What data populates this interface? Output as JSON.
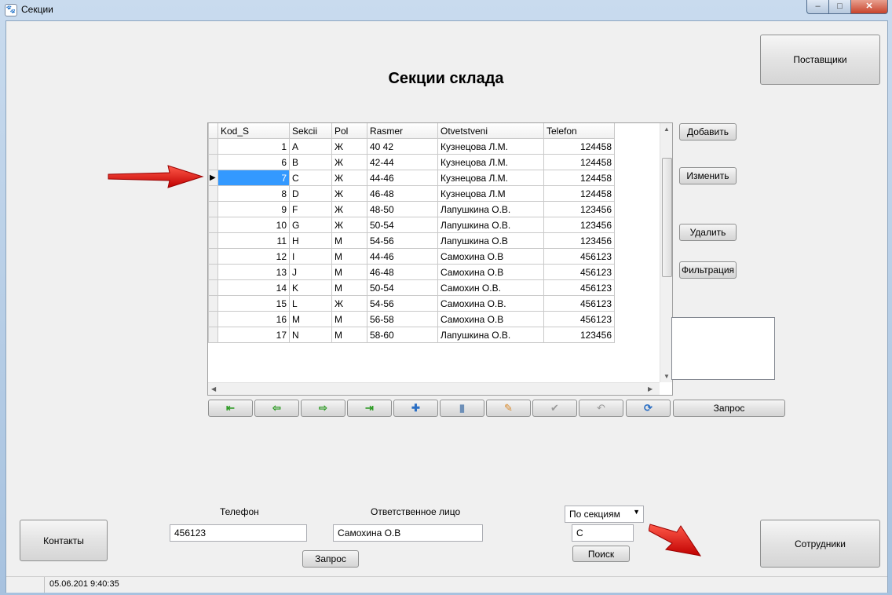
{
  "window": {
    "title": "Секции",
    "min_label": "–",
    "max_label": "□",
    "close_label": "✕"
  },
  "page_title": "Секции склада",
  "buttons": {
    "suppliers": "Поставщики",
    "add": "Добавить",
    "edit": "Изменить",
    "delete": "Удалить",
    "filter": "Фильтрация",
    "query_top": "Запрос",
    "contacts": "Контакты",
    "query_bottom": "Запрос",
    "search": "Поиск",
    "employees": "Сотрудники"
  },
  "grid": {
    "columns": [
      "Kod_S",
      "Sekcii",
      "Pol",
      "Rasmer",
      "Otvetstveni",
      "Telefon"
    ],
    "rows": [
      [
        "1",
        "A",
        "Ж",
        "40 42",
        "Кузнецова Л.М.",
        "124458"
      ],
      [
        "6",
        "B",
        "Ж",
        "42-44",
        "Кузнецова Л.М.",
        "124458"
      ],
      [
        "7",
        "C",
        "Ж",
        "44-46",
        "Кузнецова Л.М.",
        "124458"
      ],
      [
        "8",
        "D",
        "Ж",
        "46-48",
        "Кузнецова Л.М",
        "124458"
      ],
      [
        "9",
        "F",
        "Ж",
        "48-50",
        "Лапушкина О.В.",
        "123456"
      ],
      [
        "10",
        "G",
        "Ж",
        "50-54",
        "Лапушкина О.В.",
        "123456"
      ],
      [
        "11",
        "H",
        "М",
        "54-56",
        "Лапушкина О.В",
        "123456"
      ],
      [
        "12",
        "I",
        "М",
        "44-46",
        "Самохина О.В",
        "456123"
      ],
      [
        "13",
        "J",
        "М",
        "46-48",
        "Самохина О.В",
        "456123"
      ],
      [
        "14",
        "K",
        "М",
        "50-54",
        "Самохин О.В.",
        "456123"
      ],
      [
        "15",
        "L",
        "Ж",
        "54-56",
        "Самохина О.В.",
        "456123"
      ],
      [
        "16",
        "M",
        "М",
        "56-58",
        "Самохина О.В",
        "456123"
      ],
      [
        "17",
        "N",
        "М",
        "58-60",
        "Лапушкина О.В.",
        "123456"
      ]
    ],
    "selected_row": 2
  },
  "navigator": [
    {
      "name": "first",
      "glyph": "⇤"
    },
    {
      "name": "prior",
      "glyph": "⇦"
    },
    {
      "name": "next",
      "glyph": "⇨"
    },
    {
      "name": "last",
      "glyph": "⇥"
    },
    {
      "name": "insert",
      "glyph": "✚"
    },
    {
      "name": "delete",
      "glyph": "▮"
    },
    {
      "name": "edit",
      "glyph": "✎"
    },
    {
      "name": "post",
      "glyph": "✔"
    },
    {
      "name": "cancel",
      "glyph": "↶"
    },
    {
      "name": "refresh",
      "glyph": "⟳"
    }
  ],
  "labels": {
    "phone": "Телефон",
    "responsible": "Ответственное лицо"
  },
  "inputs": {
    "phone": "456123",
    "responsible": "Самохина О.В",
    "search": "С"
  },
  "combo": {
    "selected": "По секциям"
  },
  "status": {
    "datetime": "05.06.201 9:40:35"
  },
  "colors": {
    "selection": "#3399ff",
    "arrow": "#e01010"
  }
}
